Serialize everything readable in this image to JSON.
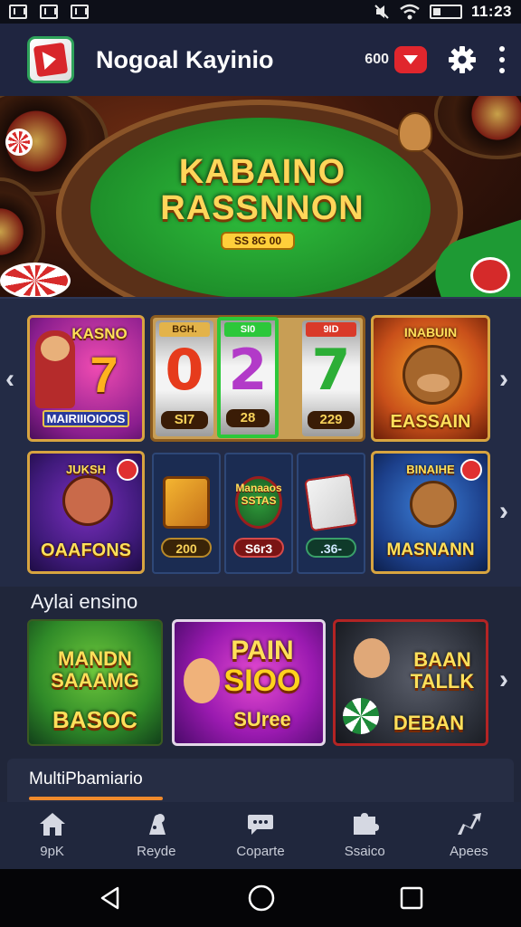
{
  "status_bar": {
    "time": "11:23"
  },
  "header": {
    "title": "Nogoal Kayinio",
    "coins": "600",
    "icons": {
      "app": "casino-logo-icon",
      "mail": "mail-icon",
      "settings": "gear-icon",
      "more": "more-vertical-icon"
    }
  },
  "banner": {
    "title_line1": "KABAINO",
    "title_line2": "RASSNNON",
    "chip_label": "SS 8G 00"
  },
  "slot_machine": {
    "reels": [
      {
        "top": "BGH.",
        "number": "0",
        "value": "SI7",
        "color": "#e63b1c"
      },
      {
        "top": "SI0",
        "number": "2",
        "value": "28",
        "color": "#b23ac8"
      },
      {
        "top": "9ID",
        "number": "7",
        "value": "229",
        "color": "#2cae36"
      }
    ]
  },
  "game_tiles": [
    {
      "title": "KASNO",
      "number": "7",
      "subtitle": "MAIRIIIOIOOS"
    },
    {
      "title": "EASSAIN",
      "top": "INABUIN"
    },
    {
      "title": "OAAFONS",
      "top": "JUKSH"
    },
    {
      "title": "MASNANN",
      "top": "BINAIHE"
    }
  ],
  "mini_tiles": [
    {
      "label": "",
      "value": "200"
    },
    {
      "label": "Manaaos SSTAS",
      "value": "S6r3"
    },
    {
      "label": "",
      "value": ".36-"
    }
  ],
  "section": {
    "title": "Aylai ensino"
  },
  "featured": [
    {
      "line1": "MANDN",
      "line2": "SAAAMG",
      "line3": "BASOC"
    },
    {
      "line1": "PAIN",
      "line2": "SIOO",
      "line3": "SUree"
    },
    {
      "line1": "BAAN",
      "line2": "TALLK",
      "line3": "DEBAN"
    }
  ],
  "multiplayer": {
    "title": "MultiPbamiario"
  },
  "bottom_nav": [
    {
      "label": "9pK",
      "icon": "home-icon"
    },
    {
      "label": "Reyde",
      "icon": "dice-icon"
    },
    {
      "label": "Coparte",
      "icon": "chat-icon"
    },
    {
      "label": "Ssaico",
      "icon": "puzzle-icon"
    },
    {
      "label": "Apees",
      "icon": "share-icon"
    }
  ],
  "colors": {
    "accent": "#f08a2c",
    "header_bg": "#1f2540",
    "panel_bg": "#232b45",
    "felt": "#1e8f2a",
    "gold": "#ffd65a"
  }
}
